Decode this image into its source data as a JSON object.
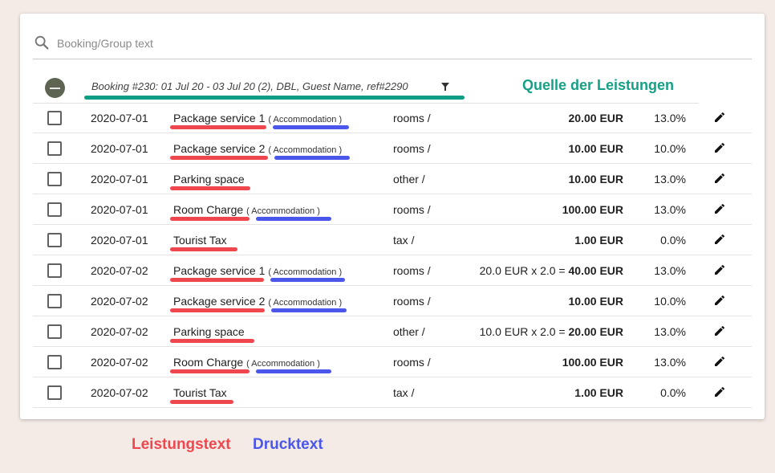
{
  "search": {
    "placeholder": "Booking/Group text",
    "value": ""
  },
  "group": {
    "title": "Booking #230: 01 Jul 20 - 03 Jul 20 (2), DBL, Guest Name, ref#2290",
    "source_label": "Quelle der Leistungen"
  },
  "rows": [
    {
      "date": "2020-07-01",
      "service": "Package service 1",
      "print": "( Accommodation )",
      "category": "rooms /",
      "calc": "",
      "amount": "20.00 EUR",
      "tax": "13.0%"
    },
    {
      "date": "2020-07-01",
      "service": "Package service 2",
      "print": "( Accommodation )",
      "category": "rooms /",
      "calc": "",
      "amount": "10.00 EUR",
      "tax": "10.0%"
    },
    {
      "date": "2020-07-01",
      "service": "Parking space",
      "print": "",
      "category": "other /",
      "calc": "",
      "amount": "10.00 EUR",
      "tax": "13.0%"
    },
    {
      "date": "2020-07-01",
      "service": "Room Charge",
      "print": "( Accommodation )",
      "category": "rooms /",
      "calc": "",
      "amount": "100.00 EUR",
      "tax": "13.0%"
    },
    {
      "date": "2020-07-01",
      "service": "Tourist Tax",
      "print": "",
      "category": "tax /",
      "calc": "",
      "amount": "1.00 EUR",
      "tax": "0.0%"
    },
    {
      "date": "2020-07-02",
      "service": "Package service 1",
      "print": "( Accommodation )",
      "category": "rooms /",
      "calc": "20.0 EUR x 2.0 =",
      "amount": "40.00 EUR",
      "tax": "13.0%"
    },
    {
      "date": "2020-07-02",
      "service": "Package service 2",
      "print": "( Accommodation )",
      "category": "rooms /",
      "calc": "",
      "amount": "10.00 EUR",
      "tax": "10.0%"
    },
    {
      "date": "2020-07-02",
      "service": "Parking space",
      "print": "",
      "category": "other /",
      "calc": "10.0 EUR x 2.0 =",
      "amount": "20.00 EUR",
      "tax": "13.0%"
    },
    {
      "date": "2020-07-02",
      "service": "Room Charge",
      "print": "( Accommodation )",
      "category": "rooms /",
      "calc": "",
      "amount": "100.00 EUR",
      "tax": "13.0%"
    },
    {
      "date": "2020-07-02",
      "service": "Tourist Tax",
      "print": "",
      "category": "tax /",
      "calc": "",
      "amount": "1.00 EUR",
      "tax": "0.0%"
    }
  ],
  "legend": {
    "service_text": "Leistungstext",
    "print_text": "Drucktext"
  },
  "colors": {
    "source": "#16a085",
    "service_underline": "#f0474f",
    "print_underline": "#4b57ea"
  }
}
